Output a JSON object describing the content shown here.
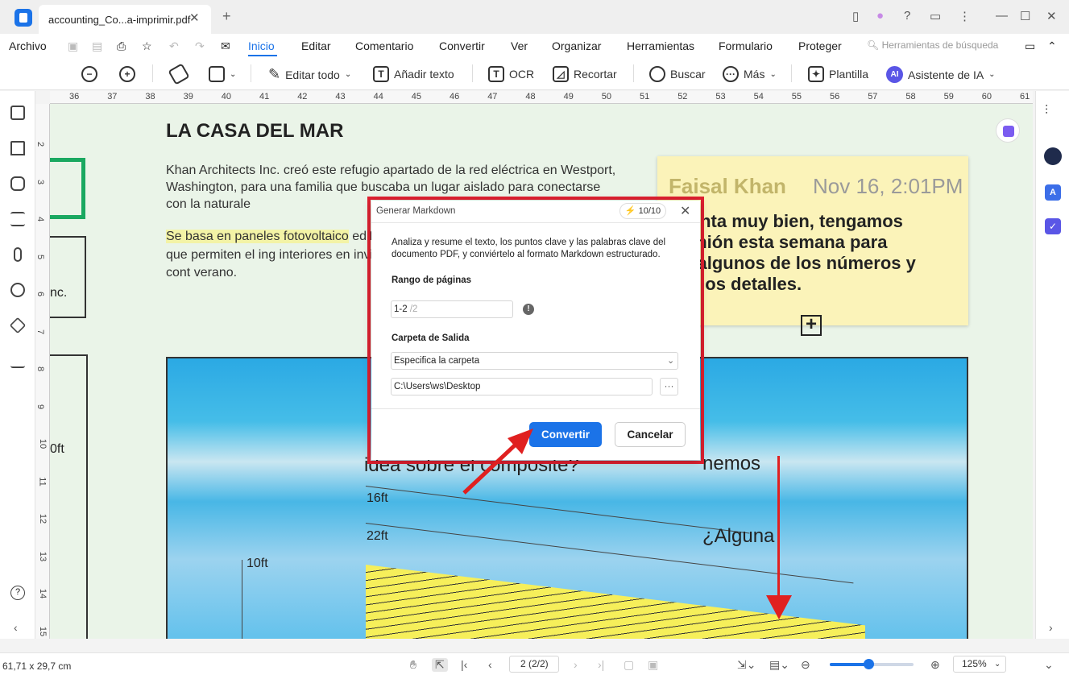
{
  "tab": {
    "title": "accounting_Co...a-imprimir.pdf",
    "close": "✕",
    "new": "+"
  },
  "window": {
    "minimize": "—",
    "maximize": "☐",
    "close": "✕",
    "more": "⋮"
  },
  "menu": {
    "archivo": "Archivo",
    "items": [
      "Inicio",
      "Editar",
      "Comentario",
      "Convertir",
      "Ver",
      "Organizar",
      "Herramientas",
      "Formulario",
      "Proteger"
    ],
    "search_placeholder": "Herramientas de búsqueda"
  },
  "toolbar": {
    "edit_all": "Editar todo",
    "add_text": "Añadir texto",
    "ocr": "OCR",
    "crop": "Recortar",
    "search": "Buscar",
    "more": "Más",
    "template": "Plantilla",
    "ai_assistant": "Asistente de IA",
    "ai_badge": "AI"
  },
  "ruler": {
    "h": [
      "36",
      "37",
      "38",
      "39",
      "40",
      "41",
      "42",
      "43",
      "44",
      "45",
      "46",
      "47",
      "48",
      "49",
      "50",
      "51",
      "52",
      "53",
      "54",
      "55",
      "56",
      "57",
      "58",
      "59",
      "60",
      "61"
    ],
    "v": [
      "2",
      "3",
      "4",
      "5",
      "6",
      "7",
      "8",
      "9",
      "10",
      "11",
      "12",
      "13",
      "14",
      "15"
    ]
  },
  "document": {
    "title": "LA CASA DEL MAR",
    "intro": "Khan Architects Inc. creó este refugio apartado de la red eléctrica en Westport, Washington, para una familia que buscaba un lugar aislado para conectarse con la naturale",
    "para2_hl": "Se basa en paneles fotovoltaico",
    "para2_rest": " edificios pasivos para regular su acristaladas que permiten el ing interiores en invierno, mientras oeste proporciona sombra cont verano.",
    "inc_label": "nc.",
    "lbl_10ft_a": "0ft",
    "overlay_text": "idea sobre el composite?",
    "overlay_right_1": "nemos",
    "overlay_right_2": "¿Alguna",
    "lbl_16ft": "16ft",
    "lbl_22ft": "22ft",
    "lbl_10ft": "10ft"
  },
  "sticky": {
    "author": "Faisal Khan",
    "date": "Nov 16, 2:01PM",
    "body": "o pinta muy bien, tengamos\n reunión esta semana para\nrar algunos de los números y\nsar los detalles."
  },
  "dialog": {
    "title": "Generar Markdown",
    "credits": "⚡ 10/10",
    "close": "✕",
    "description": "Analiza y resume el texto, los puntos clave y las palabras clave del documento PDF, y conviértelo al formato Markdown estructurado.",
    "range_label": "Rango de páginas",
    "range_value": "1-2",
    "range_total": " /2",
    "info": "!",
    "output_label": "Carpeta de Salida",
    "folder_option": "Especifica la carpeta",
    "path": "C:\\Users\\ws\\Desktop",
    "browse": "···",
    "convert": "Convertir",
    "cancel": "Cancelar"
  },
  "status": {
    "dims": "61,71 x 29,7 cm",
    "page": "2 (2/2)",
    "zoom": "125%",
    "zoom_level": 0.44
  },
  "colors": {
    "accent": "#1b73e8",
    "annotation_red": "#e02030",
    "page_bg": "#eaf4e8",
    "sticky": "#fbf3b9"
  }
}
